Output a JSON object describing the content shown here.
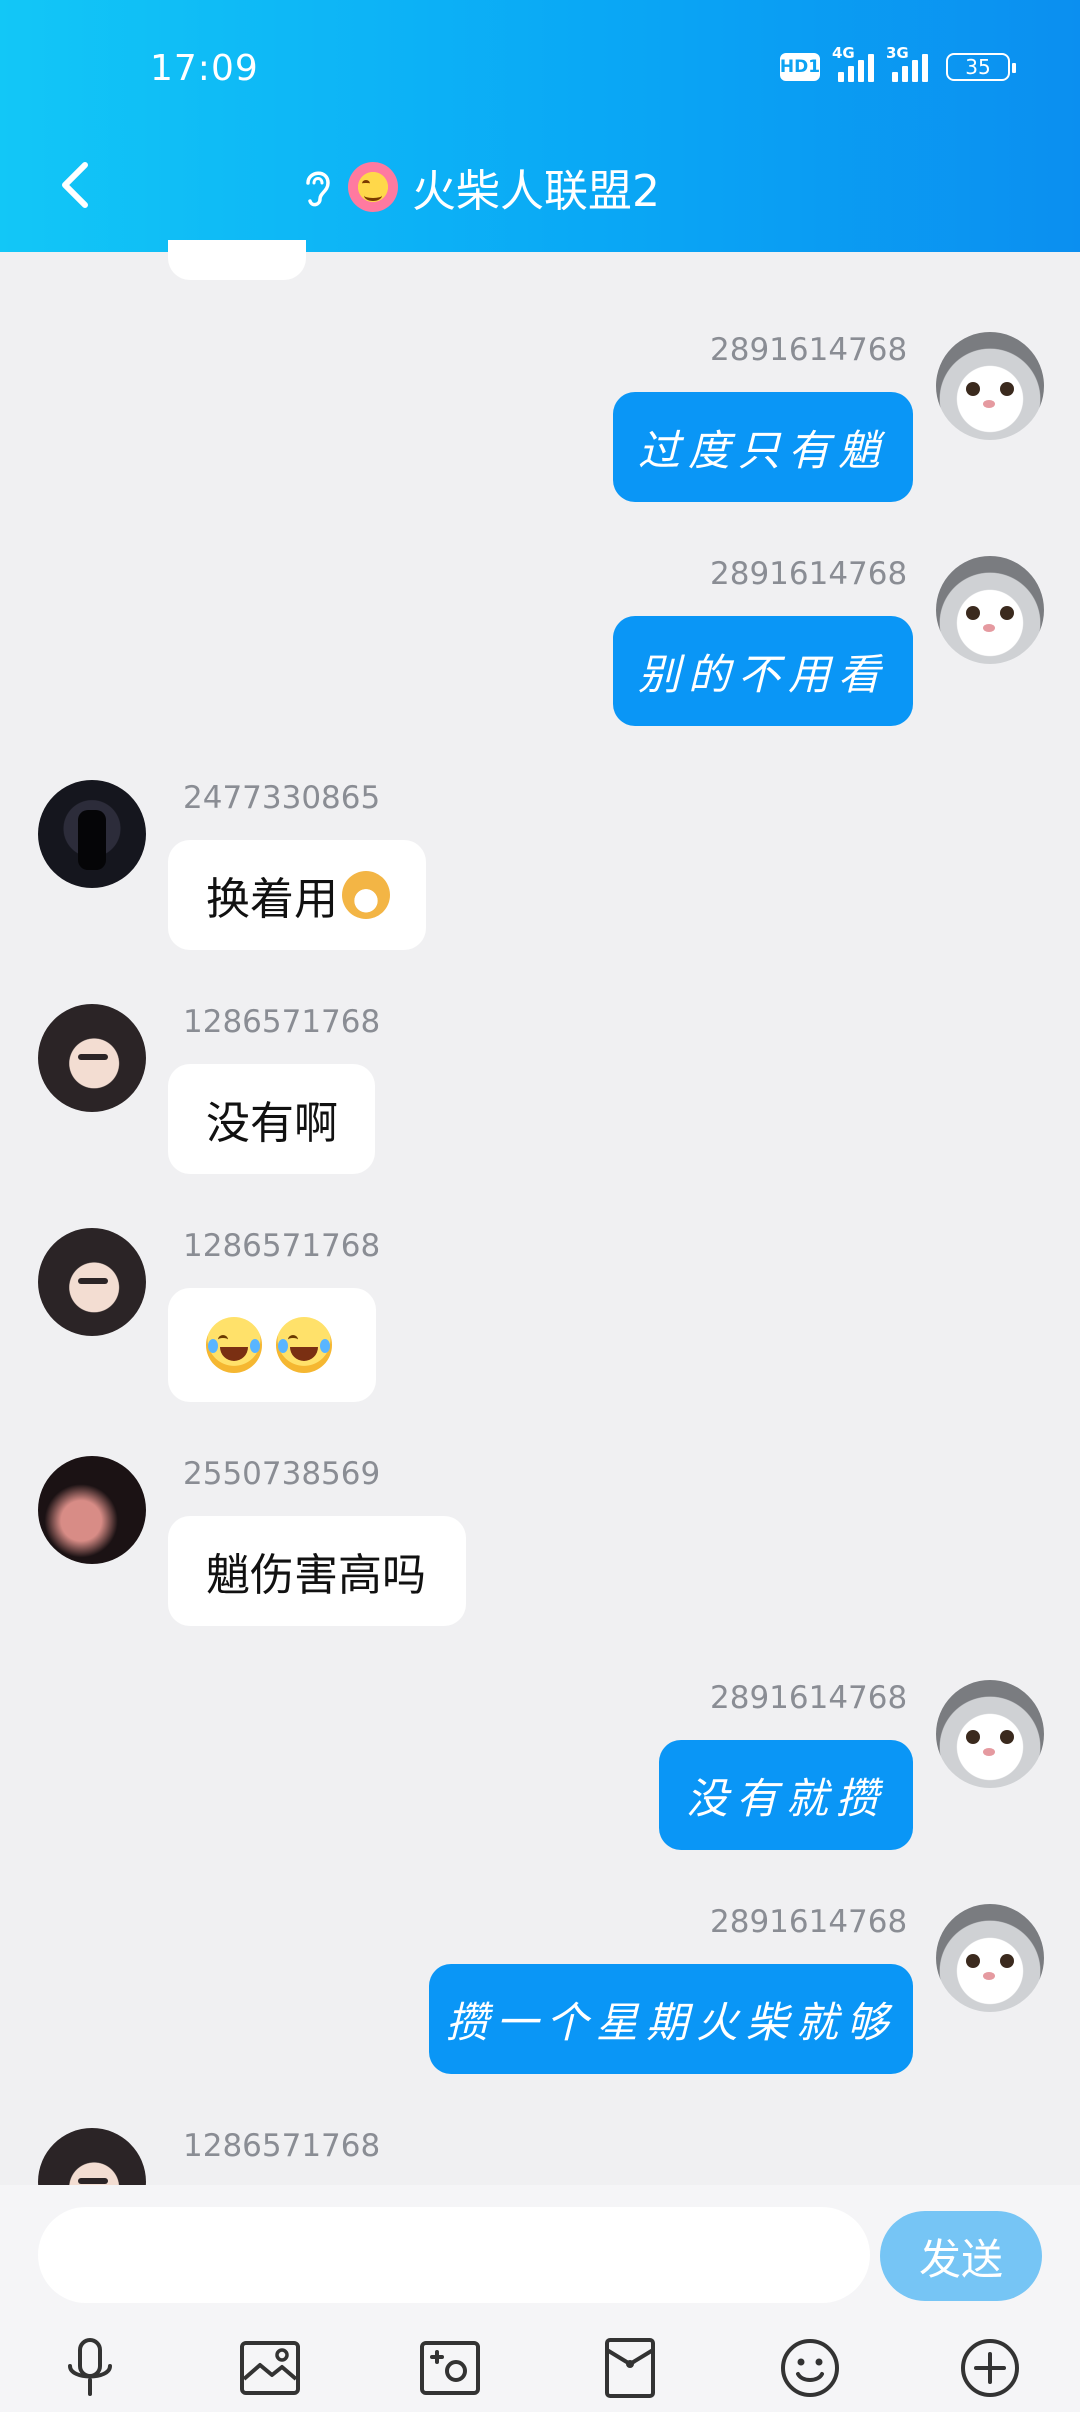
{
  "status_bar": {
    "time": "17:09",
    "hd": "HD1",
    "net1": "4G",
    "net2": "3G",
    "battery": "35"
  },
  "header": {
    "title": "火柴人联盟2"
  },
  "messages": [
    {
      "sender": "2891614768",
      "text": "过度只有魈",
      "side": "right"
    },
    {
      "sender": "2891614768",
      "text": "别的不用看",
      "side": "right"
    },
    {
      "sender": "2477330865",
      "text": "换着用",
      "side": "left"
    },
    {
      "sender": "1286571768",
      "text": "没有啊",
      "side": "left"
    },
    {
      "sender": "1286571768",
      "text": "",
      "side": "left"
    },
    {
      "sender": "2550738569",
      "text": "魈伤害高吗",
      "side": "left"
    },
    {
      "sender": "2891614768",
      "text": "没有就攒",
      "side": "right"
    },
    {
      "sender": "2891614768",
      "text": "攒一个星期火柴就够",
      "side": "right"
    },
    {
      "sender": "1286571768",
      "text": "",
      "side": "left"
    }
  ],
  "input": {
    "value": "",
    "placeholder": "",
    "send_label": "发送"
  },
  "icons": [
    "back-icon",
    "ear-icon",
    "mic-icon",
    "gallery-icon",
    "camera-icon",
    "red-packet-icon",
    "emoji-icon",
    "add-icon"
  ],
  "colors": {
    "header_start": "#12c7f7",
    "header_end": "#0b8ff0",
    "bubble_self": "#0a96f6",
    "send_button": "#76c5f5"
  }
}
